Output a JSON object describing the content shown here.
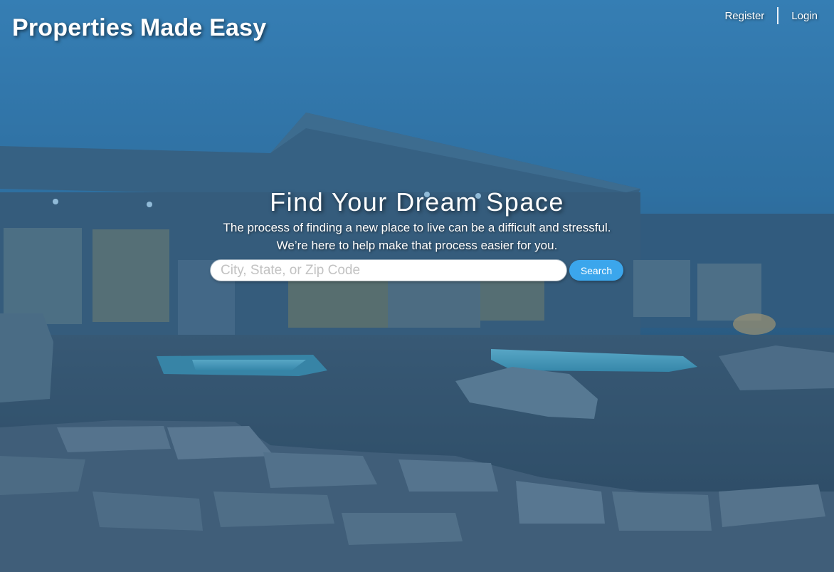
{
  "brand": {
    "title": "Properties Made Easy"
  },
  "nav": {
    "register_label": "Register",
    "login_label": "Login"
  },
  "hero": {
    "title": "Find Your Dream Space",
    "subtitle_line1": "The process of finding a new place to live can be a difficult and stressful.",
    "subtitle_line2": "We’re here to help make that process easier for you."
  },
  "search": {
    "placeholder": "City, State, or Zip Code",
    "value": "",
    "button_label": "Search"
  },
  "colors": {
    "overlay": "#2f6fa3",
    "search_button": "#3ba6ec",
    "text": "#ffffff"
  }
}
